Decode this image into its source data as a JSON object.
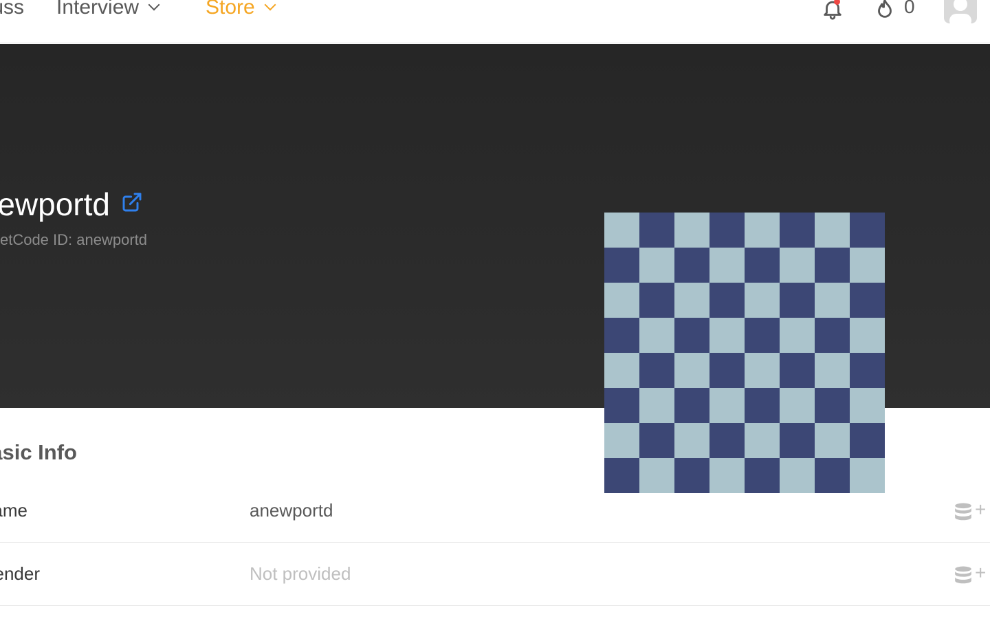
{
  "nav": {
    "discuss_label": "Discuss",
    "interview_label": "Interview",
    "store_label": "Store",
    "fire_count": "0",
    "accent_color": "#f5a623",
    "notification_color": "#ef4743"
  },
  "profile": {
    "username": "anewportd",
    "code_id": "LeetCode ID: anewportd",
    "avatar_colors": [
      "#abc4cc",
      "#3c4775"
    ]
  },
  "basic_info": {
    "title": "Basic Info",
    "rows": [
      {
        "label": "Name",
        "value": "anewportd",
        "muted": false
      },
      {
        "label": "Gender",
        "value": "Not provided",
        "muted": true
      }
    ]
  },
  "icons": [
    "chevron-down-icon",
    "bell-icon",
    "fire-icon",
    "external-link-icon",
    "database-icon",
    "plus-icon"
  ]
}
